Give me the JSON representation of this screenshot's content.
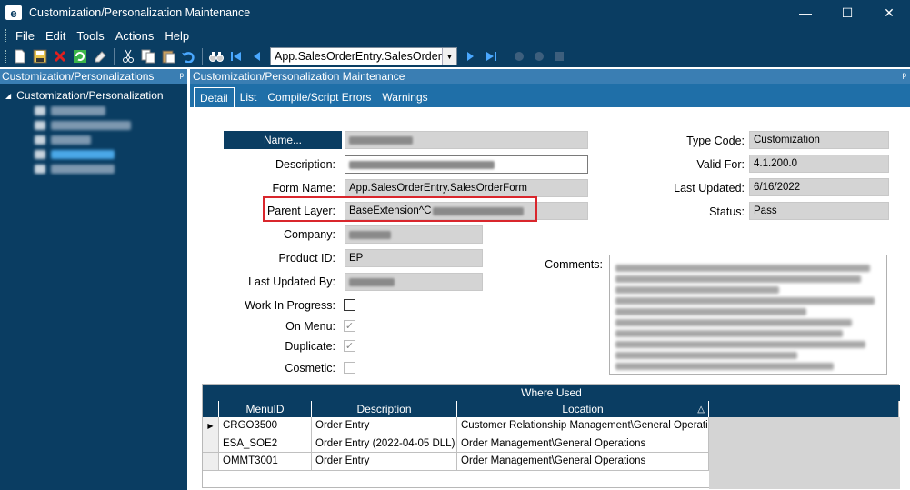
{
  "window": {
    "logo": "e",
    "title": "Customization/Personalization Maintenance",
    "controls": {
      "minimize": "—",
      "maximize": "☐",
      "close": "✕"
    }
  },
  "menu": [
    "File",
    "Edit",
    "Tools",
    "Actions",
    "Help"
  ],
  "toolbar": {
    "form_select_value": "App.SalesOrderEntry.SalesOrder",
    "icons": [
      "new-icon",
      "save-icon",
      "delete-icon",
      "refresh-icon",
      "clear-icon",
      "cut-icon",
      "copy-icon",
      "paste-icon",
      "undo-icon",
      "binoculars-icon",
      "first-icon",
      "prev-icon",
      "next-icon",
      "last-icon"
    ]
  },
  "left_panel": {
    "header": "Customization/Personalizations",
    "pin": "ᵖ",
    "tree_root": "Customization/Personalization"
  },
  "right_panel": {
    "header": "Customization/Personalization Maintenance",
    "pin": "ᵖ",
    "tabs": [
      "Detail",
      "List",
      "Compile/Script Errors",
      "Warnings"
    ]
  },
  "form": {
    "name_button": "Name...",
    "description_label": "Description:",
    "form_name_label": "Form Name:",
    "form_name_value": "App.SalesOrderEntry.SalesOrderForm",
    "parent_layer_label": "Parent Layer:",
    "parent_layer_value_prefix": "BaseExtension^C",
    "company_label": "Company:",
    "product_id_label": "Product ID:",
    "product_id_value": "EP",
    "last_updated_by_label": "Last Updated By:",
    "wip_label": "Work In Progress:",
    "on_menu_label": "On Menu:",
    "duplicate_label": "Duplicate:",
    "cosmetic_label": "Cosmetic:",
    "comments_label": "Comments:",
    "type_code_label": "Type Code:",
    "type_code_value": "Customization",
    "valid_for_label": "Valid For:",
    "valid_for_value": "4.1.200.0",
    "last_updated_label": "Last Updated:",
    "last_updated_value": "6/16/2022",
    "status_label": "Status:",
    "status_value": "Pass",
    "check_mark": "✓"
  },
  "where_used": {
    "title": "Where Used",
    "columns": [
      "MenuID",
      "Description",
      "Location"
    ],
    "sort_indicator": "△",
    "row_marker": "▶",
    "rows": [
      {
        "menuid": "CRGO3500",
        "description": "Order Entry",
        "location": "Customer Relationship Management\\General Operati"
      },
      {
        "menuid": "ESA_SOE2",
        "description": "Order Entry (2022-04-05 DLL)",
        "location": "Order Management\\General Operations"
      },
      {
        "menuid": "OMMT3001",
        "description": "Order Entry",
        "location": "Order Management\\General Operations"
      }
    ]
  },
  "colors": {
    "dark_blue": "#0a3d62",
    "header_blue": "#3a7eb3",
    "tab_blue": "#1f6fa8",
    "highlight_red": "#d9262c"
  }
}
